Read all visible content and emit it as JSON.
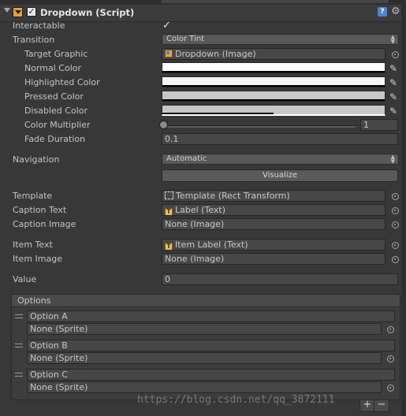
{
  "header": {
    "title": "Dropdown (Script)",
    "enabled": true,
    "help_icon": "help-icon",
    "settings_icon": "gear-icon",
    "help_glyph": "?"
  },
  "properties": {
    "interactable": {
      "label": "Interactable",
      "checked": true,
      "glyph": "✓"
    },
    "transition": {
      "label": "Transition",
      "value": "Color Tint"
    },
    "target_graphic": {
      "label": "Target Graphic",
      "value": "Dropdown (Image)",
      "icon": "image-icon"
    },
    "normal_color": {
      "label": "Normal Color",
      "color": "#ffffff",
      "alpha": 1.0
    },
    "highlighted_color": {
      "label": "Highlighted Color",
      "color": "#f5f5f5",
      "alpha": 1.0
    },
    "pressed_color": {
      "label": "Pressed Color",
      "color": "#c8c8c8",
      "alpha": 1.0
    },
    "disabled_color": {
      "label": "Disabled Color",
      "color": "#c8c8c8",
      "alpha": 0.5
    },
    "color_multiplier": {
      "label": "Color Multiplier",
      "value": "1",
      "slider_fraction": 0.0
    },
    "fade_duration": {
      "label": "Fade Duration",
      "value": "0.1"
    },
    "navigation": {
      "label": "Navigation",
      "value": "Automatic",
      "visualize_label": "Visualize"
    },
    "template": {
      "label": "Template",
      "value": "Template (Rect Transform)",
      "icon": "rect-transform-icon"
    },
    "caption_text": {
      "label": "Caption Text",
      "value": "Label (Text)",
      "icon": "text-icon"
    },
    "caption_image": {
      "label": "Caption Image",
      "value": "None (Image)"
    },
    "item_text": {
      "label": "Item Text",
      "value": "Item Label (Text)",
      "icon": "text-icon"
    },
    "item_image": {
      "label": "Item Image",
      "value": "None (Image)"
    },
    "value": {
      "label": "Value",
      "value": "0"
    }
  },
  "options": {
    "label": "Options",
    "items": [
      {
        "text": "Option A",
        "sprite": "None (Sprite)"
      },
      {
        "text": "Option B",
        "sprite": "None (Sprite)"
      },
      {
        "text": "Option C",
        "sprite": "None (Sprite)"
      }
    ],
    "add_glyph": "+",
    "remove_glyph": "−"
  },
  "glyphs": {
    "popup_arrows": "▲▼",
    "eyedropper": "✎",
    "text_icon": "T",
    "gear": "⚙"
  },
  "watermark": "https://blog.csdn.net/qq_3872111"
}
